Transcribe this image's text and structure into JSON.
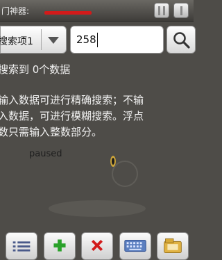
{
  "app": {
    "title": "门神器:"
  },
  "search": {
    "field_selector_label": "搜索项1",
    "input_value": "258"
  },
  "result_text": "搜索到 0个数据",
  "help_lines": [
    "输入数据可进行精确搜索；不输",
    "入数据，可进行模糊搜索。浮点",
    "数只需输入整数部分。"
  ],
  "background_text": {
    "paused": "paused"
  },
  "toolbar": {
    "items": [
      {
        "icon": "list-icon"
      },
      {
        "icon": "add-icon"
      },
      {
        "icon": "delete-icon"
      },
      {
        "icon": "keyboard-icon"
      },
      {
        "icon": "folder-icon"
      }
    ]
  },
  "colors": {
    "background": "#4e4c48",
    "add": "#2aa12a",
    "delete": "#d21a1a",
    "title_scribble": "#d21a1a"
  }
}
